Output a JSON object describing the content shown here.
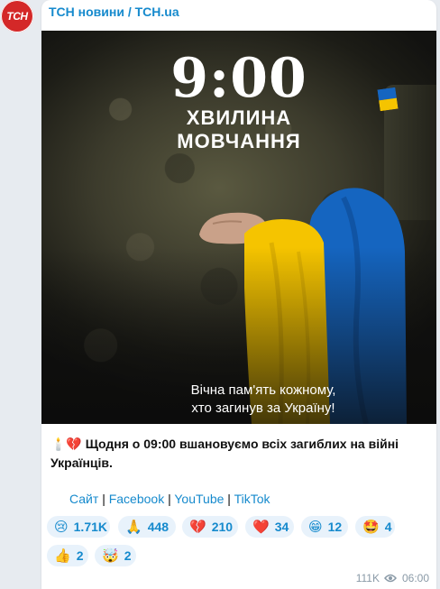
{
  "channel": {
    "avatar_text": "ТСН",
    "name": "ТСН новини / TCH.ua"
  },
  "photo": {
    "time": "9:00",
    "line1": "ХВИЛИНА",
    "line2": "МОВЧАННЯ",
    "memory1": "Вічна пам'ять кожному,",
    "memory2": "хто загинув за Україну!"
  },
  "message": {
    "icons": "🕯️💔",
    "text": "Щодня о 09:00 вшановуємо всіх загиблих на війні Українців."
  },
  "links": {
    "site": "Сайт",
    "facebook": "Facebook",
    "youtube": "YouTube",
    "tiktok": "TikTok",
    "separator": "|"
  },
  "reactions": [
    {
      "emoji": "😢",
      "count": "1.71K"
    },
    {
      "emoji": "🙏",
      "count": "448"
    },
    {
      "emoji": "💔",
      "count": "210"
    },
    {
      "emoji": "❤️",
      "count": "34"
    },
    {
      "emoji": "😁",
      "count": "12"
    },
    {
      "emoji": "🤩",
      "count": "4"
    },
    {
      "emoji": "👍",
      "count": "2"
    },
    {
      "emoji": "🤯",
      "count": "2"
    }
  ],
  "meta": {
    "views": "111K",
    "time": "06:00"
  },
  "colors": {
    "link": "#168acd",
    "avatar": "#d42828",
    "flag_blue": "#1565c0",
    "flag_yellow": "#f5c400"
  }
}
